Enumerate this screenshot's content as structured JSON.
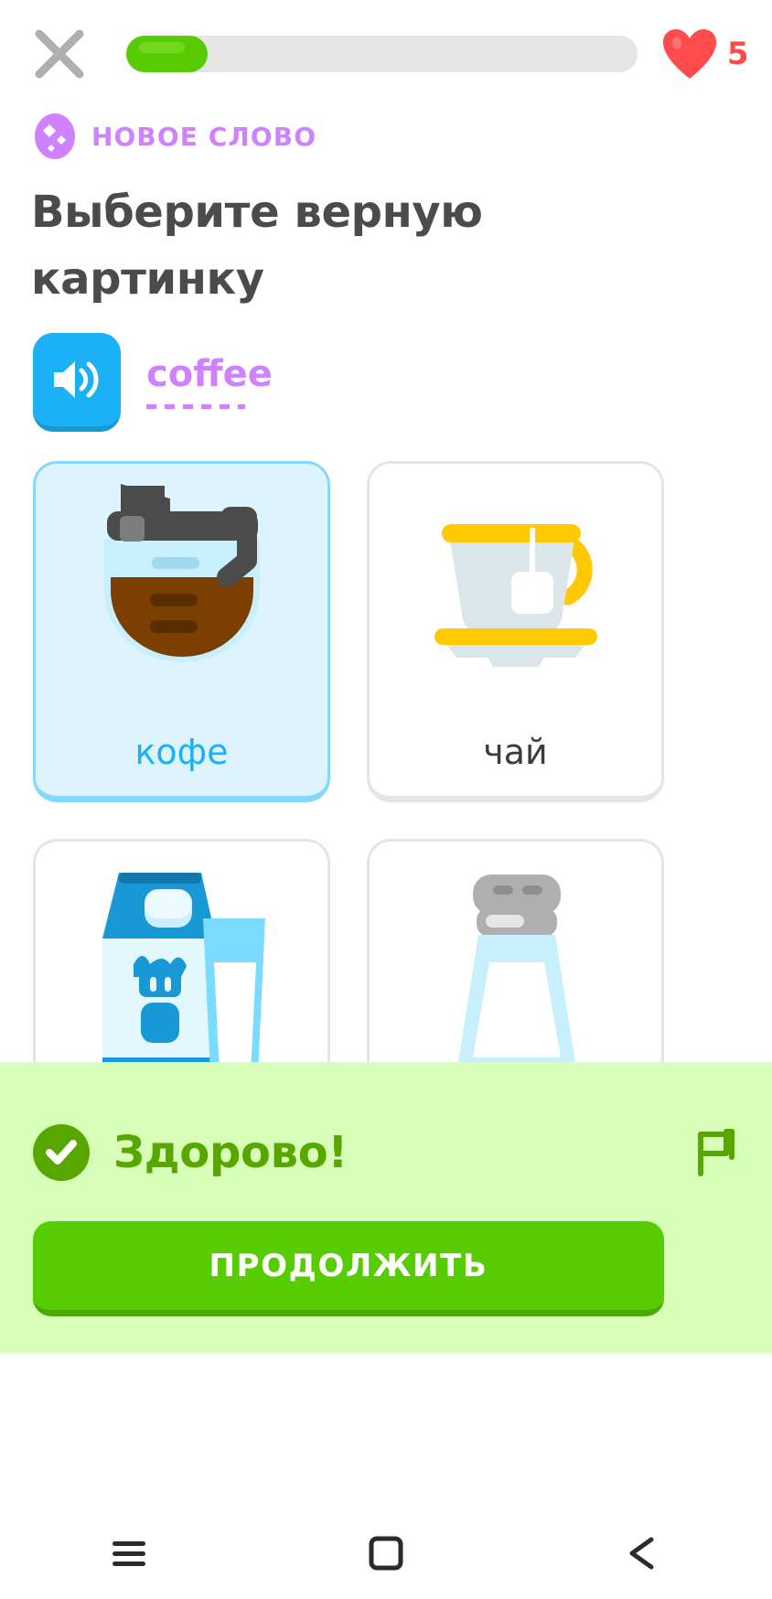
{
  "header": {
    "close_icon": "close-x-icon",
    "progress": {
      "percent": 16,
      "fill_color": "#58CC02",
      "track_color": "#E5E5E5"
    },
    "hearts": {
      "icon": "heart-icon",
      "count": "5",
      "color": "#FF4B4B"
    }
  },
  "badge": {
    "icon": "new-word-diamond-icon",
    "label": "НОВОЕ СЛОВО",
    "color": "#CE82FF"
  },
  "question": {
    "title": "Выберите верную картинку",
    "title_color": "#4B4B4B"
  },
  "prompt": {
    "audio_icon": "speaker-icon",
    "audio_button_color": "#1CB0F6",
    "word": "coffee",
    "word_color": "#CE82FF",
    "underline_style": "dashed"
  },
  "choices": [
    {
      "label": "кофе",
      "art": "coffee-pot-image",
      "selected": true,
      "label_color": "#1CB0F6"
    },
    {
      "label": "чай",
      "art": "tea-cup-image",
      "selected": false,
      "label_color": "#3C3C3C"
    },
    {
      "label": "",
      "art": "milk-carton-image",
      "selected": false,
      "label_color": "#3C3C3C"
    },
    {
      "label": "",
      "art": "water-bottle-image",
      "selected": false,
      "label_color": "#3C3C3C"
    }
  ],
  "feedback": {
    "check_icon": "check-circle-icon",
    "title": "Здорово!",
    "title_color": "#58A700",
    "banner_color": "#D7FFB8",
    "flag_icon": "report-flag-icon",
    "continue_label": "ПРОДОЛЖИТЬ",
    "continue_color": "#58CC02"
  },
  "navbar": {
    "recents_icon": "menu-icon",
    "home_icon": "home-square-icon",
    "back_icon": "back-triangle-icon"
  }
}
